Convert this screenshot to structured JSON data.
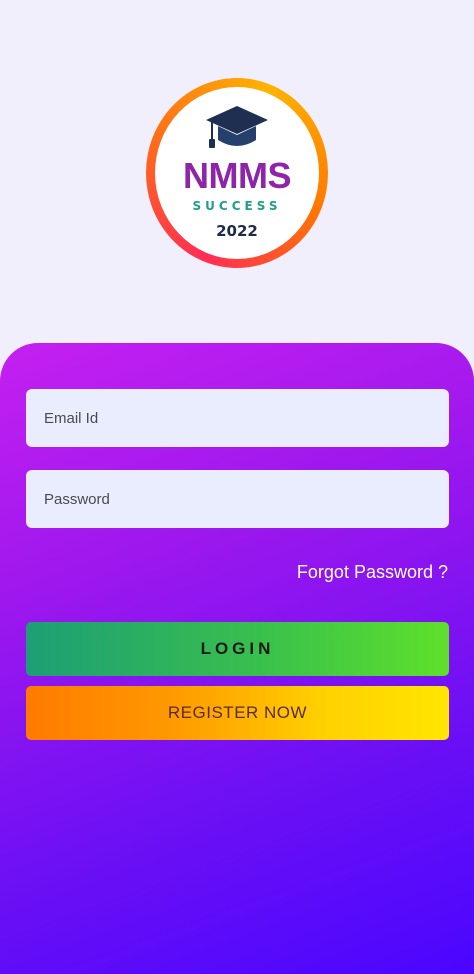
{
  "logo": {
    "title": "NMMS",
    "subtitle": "SUCCESS",
    "year": "2022",
    "icon": "graduation-cap-icon",
    "ring_colors": [
      "#ff2d55",
      "#ffb300"
    ],
    "title_color": "#8e24aa",
    "subtitle_color": "#1f9e8c"
  },
  "form": {
    "email_placeholder": "Email Id",
    "email_value": "",
    "password_placeholder": "Password",
    "password_value": "",
    "forgot_label": "Forgot Password ?"
  },
  "buttons": {
    "login_label": "LOGIN",
    "register_label": "REGISTER NOW"
  },
  "colors": {
    "background": "#f1effc",
    "card_gradient": [
      "#c520f0",
      "#4a06ff"
    ],
    "login_gradient": [
      "#1d9e76",
      "#5fe02a"
    ],
    "register_gradient": [
      "#ff7a00",
      "#ffe600"
    ]
  }
}
